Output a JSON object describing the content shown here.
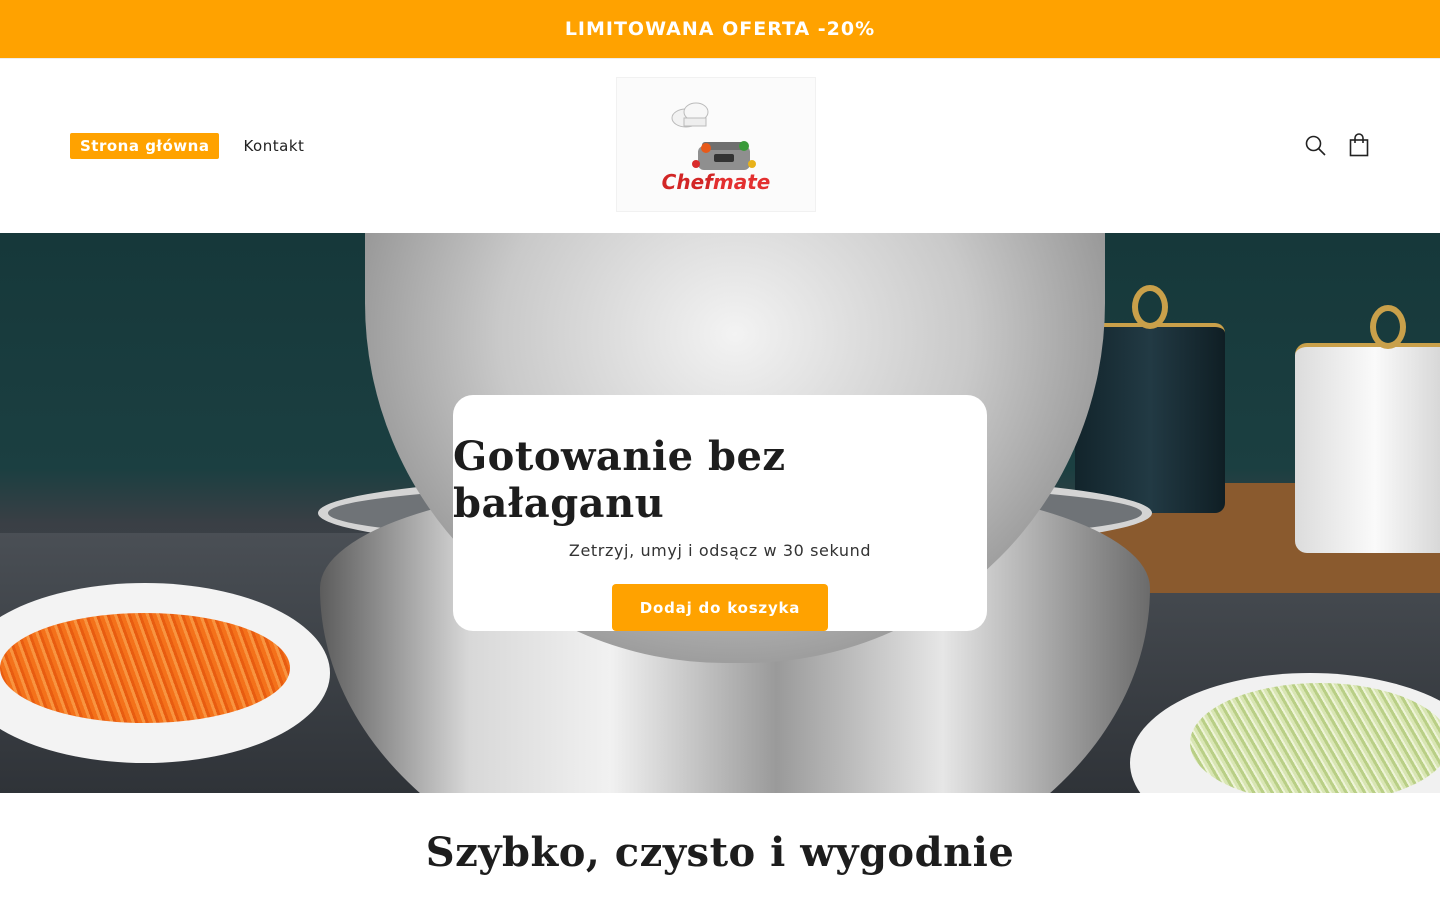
{
  "announcement": {
    "text": "LIMITOWANA OFERTA -20%",
    "background": "#ffa200"
  },
  "header": {
    "nav": [
      {
        "label": "Strona główna",
        "active": true
      },
      {
        "label": "Kontakt",
        "active": false
      }
    ],
    "logo": {
      "brand_part1": "Chef",
      "brand_part2": "mate"
    },
    "icons": [
      "search-icon",
      "cart-icon"
    ]
  },
  "hero": {
    "title": "Gotowanie bez bałaganu",
    "subtitle": "Zetrzyj, umyj i odsącz w 30 sekund",
    "cta_label": "Dodaj do koszyka",
    "accent": "#ffa200"
  },
  "section": {
    "title": "Szybko, czysto i wygodnie"
  }
}
